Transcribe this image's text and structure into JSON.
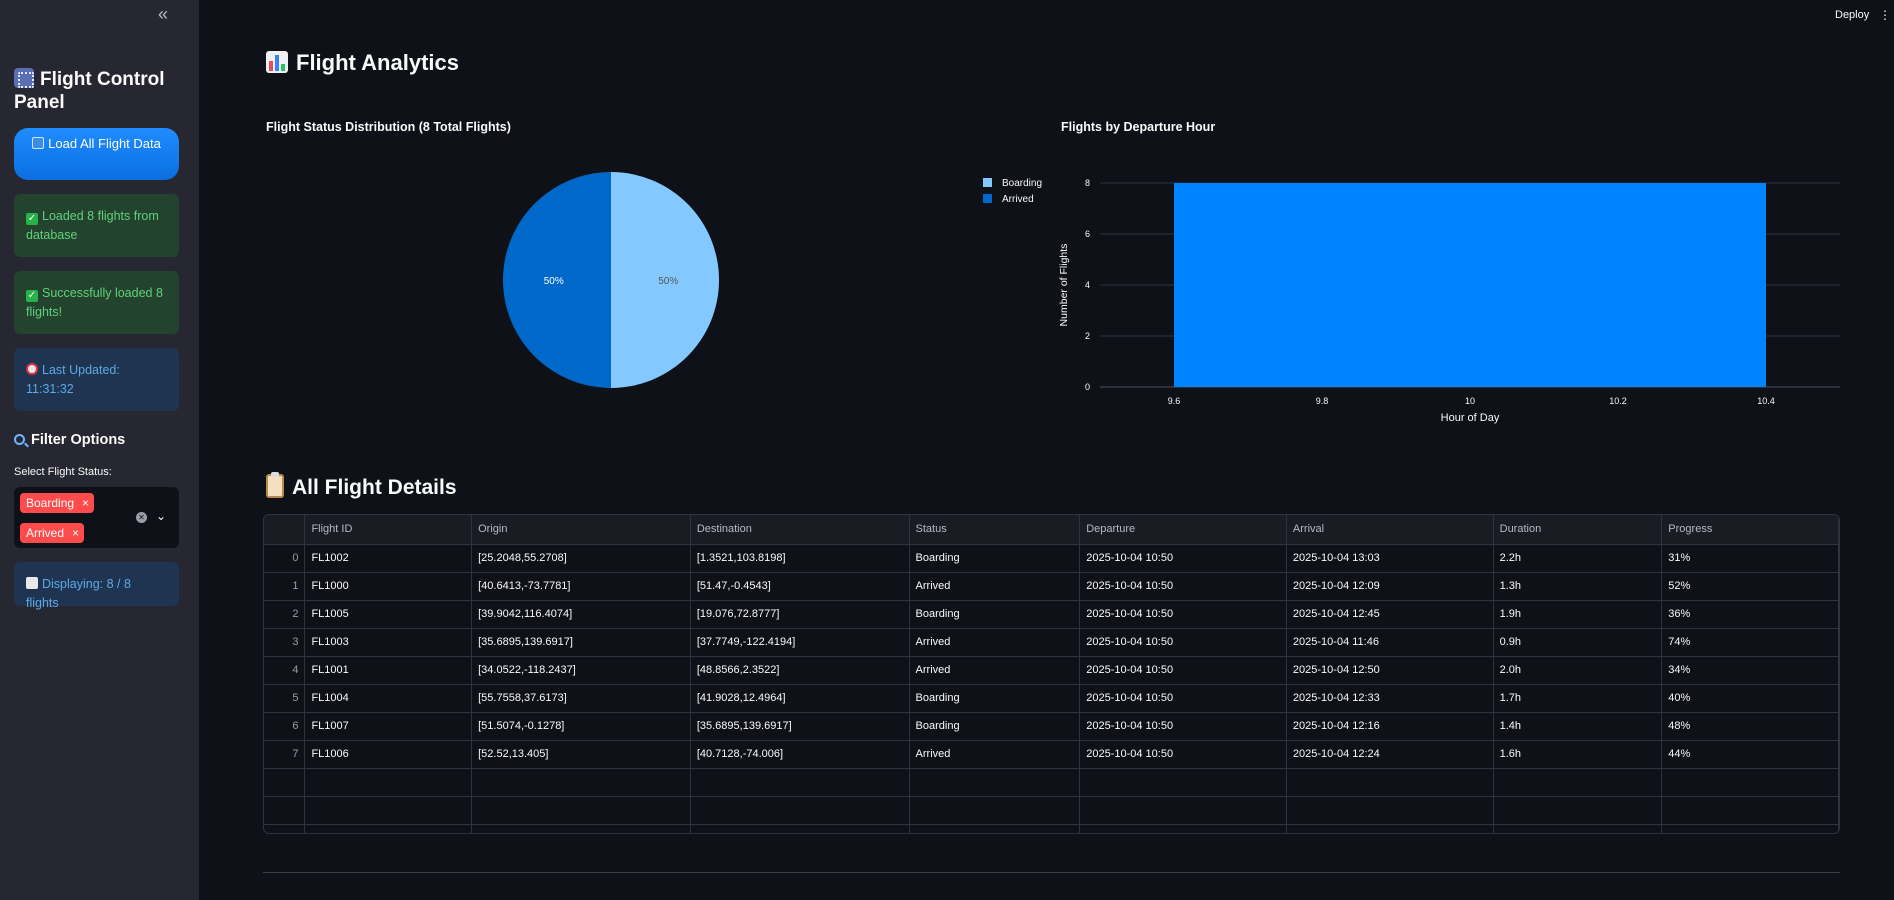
{
  "header": {
    "deploy_label": "Deploy"
  },
  "sidebar": {
    "title": "Flight Control Panel",
    "load_button": "Load All Flight Data",
    "alert_loaded": "Loaded 8 flights from database",
    "alert_success": "Successfully loaded 8 flights!",
    "last_updated": "Last Updated: 11:31:32",
    "filter_heading": "Filter Options",
    "select_label": "Select Flight Status:",
    "selected_tags": [
      "Boarding",
      "Arrived"
    ],
    "displaying": "Displaying: 8 / 8 flights"
  },
  "main": {
    "title": "Flight Analytics",
    "details_title": "All Flight Details"
  },
  "chart_data": [
    {
      "type": "pie",
      "title": "Flight Status Distribution (8 Total Flights)",
      "labels": [
        "Boarding",
        "Arrived"
      ],
      "values": [
        4,
        4
      ],
      "percent_labels": [
        "50%",
        "50%"
      ],
      "colors": [
        "#83c9ff",
        "#0068c9"
      ],
      "legend": "right"
    },
    {
      "type": "bar",
      "title": "Flights by Departure Hour",
      "xlabel": "Hour of Day",
      "ylabel": "Number of Flights",
      "x": [
        10
      ],
      "values": [
        8
      ],
      "bar_width": 0.8,
      "xlim": [
        9.5,
        10.5
      ],
      "ylim": [
        0,
        8
      ],
      "x_ticks": [
        9.6,
        9.8,
        10,
        10.2,
        10.4
      ],
      "x_tick_labels": [
        "9.6",
        "9.8",
        "10",
        "10.2",
        "10.4"
      ],
      "y_ticks": [
        0,
        2,
        4,
        6,
        8
      ],
      "color": "#0083ff",
      "grid": true
    }
  ],
  "table": {
    "columns": [
      "",
      "Flight ID",
      "Origin",
      "Destination",
      "Status",
      "Departure",
      "Arrival",
      "Duration",
      "Progress"
    ],
    "rows": [
      [
        "0",
        "FL1002",
        "[25.2048,55.2708]",
        "[1.3521,103.8198]",
        "Boarding",
        "2025-10-04 10:50",
        "2025-10-04 13:03",
        "2.2h",
        "31%"
      ],
      [
        "1",
        "FL1000",
        "[40.6413,-73.7781]",
        "[51.47,-0.4543]",
        "Arrived",
        "2025-10-04 10:50",
        "2025-10-04 12:09",
        "1.3h",
        "52%"
      ],
      [
        "2",
        "FL1005",
        "[39.9042,116.4074]",
        "[19.076,72.8777]",
        "Boarding",
        "2025-10-04 10:50",
        "2025-10-04 12:45",
        "1.9h",
        "36%"
      ],
      [
        "3",
        "FL1003",
        "[35.6895,139.6917]",
        "[37.7749,-122.4194]",
        "Arrived",
        "2025-10-04 10:50",
        "2025-10-04 11:46",
        "0.9h",
        "74%"
      ],
      [
        "4",
        "FL1001",
        "[34.0522,-118.2437]",
        "[48.8566,2.3522]",
        "Arrived",
        "2025-10-04 10:50",
        "2025-10-04 12:50",
        "2.0h",
        "34%"
      ],
      [
        "5",
        "FL1004",
        "[55.7558,37.6173]",
        "[41.9028,12.4964]",
        "Boarding",
        "2025-10-04 10:50",
        "2025-10-04 12:33",
        "1.7h",
        "40%"
      ],
      [
        "6",
        "FL1007",
        "[51.5074,-0.1278]",
        "[35.6895,139.6917]",
        "Boarding",
        "2025-10-04 10:50",
        "2025-10-04 12:16",
        "1.4h",
        "48%"
      ],
      [
        "7",
        "FL1006",
        "[52.52,13.405]",
        "[40.7128,-74.006]",
        "Arrived",
        "2025-10-04 10:50",
        "2025-10-04 12:24",
        "1.6h",
        "44%"
      ]
    ]
  }
}
